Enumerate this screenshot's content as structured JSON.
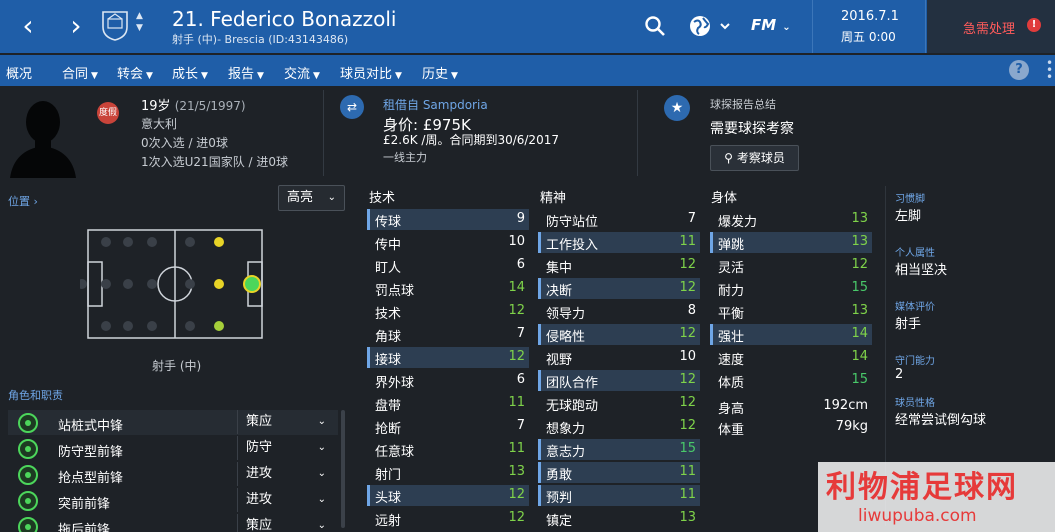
{
  "header": {
    "back": "‹",
    "forward": "›",
    "title": "21. Federico Bonazzoli",
    "subtitle": "射手 (中)- Brescia (ID:43143486)",
    "fm_label": "FM",
    "date": "2016.7.1",
    "day_time": "周五 0:00",
    "alert_label": "急需处理",
    "alert_mark": "!"
  },
  "menu": [
    {
      "label": "概况",
      "caret": false
    },
    {
      "label": "合同",
      "caret": true
    },
    {
      "label": "转会",
      "caret": true
    },
    {
      "label": "成长",
      "caret": true
    },
    {
      "label": "报告",
      "caret": true
    },
    {
      "label": "交流",
      "caret": true
    },
    {
      "label": "球员对比",
      "caret": true
    },
    {
      "label": "历史",
      "caret": true
    }
  ],
  "menu_help": "?",
  "player": {
    "badge": "度假",
    "age_line": "19岁",
    "dob": "(21/5/1997)",
    "nation": "意大利",
    "caps1": "0次入选 / 进0球",
    "caps2": "1次入选U21国家队 / 进0球"
  },
  "contract": {
    "loan": "租借自 Sampdoria",
    "value": "身价: £975K",
    "wage": "£2.6K /周。合同期到30/6/2017",
    "role": "一线主力"
  },
  "scout": {
    "title": "球探报告总结",
    "need": "需要球探考察",
    "button": "考察球员"
  },
  "position": {
    "link": "位置",
    "dropdown": "高亮",
    "label": "射手 (中)"
  },
  "roles": {
    "label": "角色和职责",
    "items": [
      {
        "name": "站桩式中锋",
        "duty": "策应"
      },
      {
        "name": "防守型前锋",
        "duty": "防守"
      },
      {
        "name": "抢点型前锋",
        "duty": "进攻"
      },
      {
        "name": "突前前锋",
        "duty": "进攻"
      },
      {
        "name": "拖后前锋",
        "duty": "策应"
      }
    ]
  },
  "technical": {
    "title": "技术",
    "items": [
      {
        "name": "传球",
        "value": "9",
        "hl": true
      },
      {
        "name": "传中",
        "value": "10",
        "hl": false
      },
      {
        "name": "盯人",
        "value": "6",
        "hl": false
      },
      {
        "name": "罚点球",
        "value": "14",
        "hl": false
      },
      {
        "name": "技术",
        "value": "12",
        "hl": false
      },
      {
        "name": "角球",
        "value": "7",
        "hl": false
      },
      {
        "name": "接球",
        "value": "12",
        "hl": true
      },
      {
        "name": "界外球",
        "value": "6",
        "hl": false
      },
      {
        "name": "盘带",
        "value": "11",
        "hl": false
      },
      {
        "name": "抢断",
        "value": "7",
        "hl": false
      },
      {
        "name": "任意球",
        "value": "11",
        "hl": false
      },
      {
        "name": "射门",
        "value": "13",
        "hl": false
      },
      {
        "name": "头球",
        "value": "12",
        "hl": true
      },
      {
        "name": "远射",
        "value": "12",
        "hl": false
      }
    ]
  },
  "mental": {
    "title": "精神",
    "items": [
      {
        "name": "防守站位",
        "value": "7",
        "hl": false
      },
      {
        "name": "工作投入",
        "value": "11",
        "hl": true
      },
      {
        "name": "集中",
        "value": "12",
        "hl": false
      },
      {
        "name": "决断",
        "value": "12",
        "hl": true
      },
      {
        "name": "领导力",
        "value": "8",
        "hl": false
      },
      {
        "name": "侵略性",
        "value": "12",
        "hl": true
      },
      {
        "name": "视野",
        "value": "10",
        "hl": false
      },
      {
        "name": "团队合作",
        "value": "12",
        "hl": true
      },
      {
        "name": "无球跑动",
        "value": "12",
        "hl": false
      },
      {
        "name": "想象力",
        "value": "12",
        "hl": false
      },
      {
        "name": "意志力",
        "value": "15",
        "hl": true
      },
      {
        "name": "勇敢",
        "value": "11",
        "hl": true
      },
      {
        "name": "预判",
        "value": "11",
        "hl": true
      },
      {
        "name": "镇定",
        "value": "13",
        "hl": false
      }
    ]
  },
  "physical": {
    "title": "身体",
    "items": [
      {
        "name": "爆发力",
        "value": "13",
        "hl": false
      },
      {
        "name": "弹跳",
        "value": "13",
        "hl": true
      },
      {
        "name": "灵活",
        "value": "12",
        "hl": false
      },
      {
        "name": "耐力",
        "value": "15",
        "hl": false
      },
      {
        "name": "平衡",
        "value": "13",
        "hl": false
      },
      {
        "name": "强壮",
        "value": "14",
        "hl": true
      },
      {
        "name": "速度",
        "value": "14",
        "hl": false
      },
      {
        "name": "体质",
        "value": "15",
        "hl": false
      }
    ],
    "height_label": "身高",
    "height": "192cm",
    "weight_label": "体重",
    "weight": "79kg"
  },
  "side": [
    {
      "label": "习惯脚",
      "value": "左脚"
    },
    {
      "label": "个人属性",
      "value": "相当坚决"
    },
    {
      "label": "媒体评价",
      "value": "射手"
    },
    {
      "label": "守门能力",
      "value": "2"
    },
    {
      "label": "球员性格",
      "value": "经常尝试倒勾球"
    }
  ],
  "watermark": {
    "line1": "利物浦足球网",
    "line2": "liwupuba.com"
  },
  "colors": {
    "topbar": "#1f5ea8",
    "background": "#1e2227",
    "accent": "#6fa6e6",
    "attr_green": "#7fd34a",
    "highlight": "#2d3e52",
    "alert": "#e03c3c"
  }
}
